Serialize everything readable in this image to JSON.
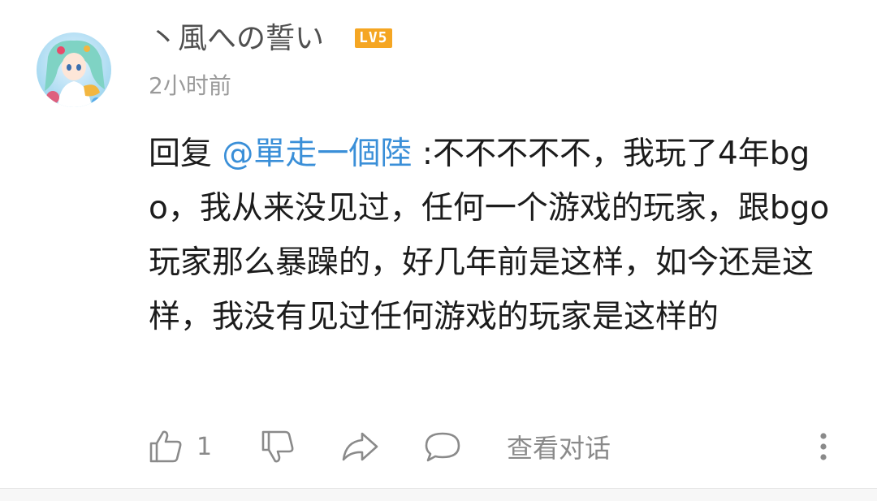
{
  "comment": {
    "username": "丶風への誓い",
    "level": "LV5",
    "timestamp": "2小时前",
    "reply_prefix": "回复 ",
    "mention": "@單走一個陸",
    "body": " :不不不不不，我玩了4年bgo，我从来没见过，任何一个游戏的玩家，跟bgo玩家那么暴躁的，好几年前是这样，如今还是这样，我没有见过任何游戏的玩家是这样的"
  },
  "actions": {
    "like_count": "1",
    "view_conversation": "查看对话"
  },
  "icons": {
    "like": "thumbs-up-icon",
    "dislike": "thumbs-down-icon",
    "share": "share-icon",
    "reply": "comment-bubble-icon",
    "more": "more-vertical-icon"
  },
  "colors": {
    "mention": "#3a8fd8",
    "level_badge": "#f5a623",
    "muted_text": "#8a8a8a"
  }
}
